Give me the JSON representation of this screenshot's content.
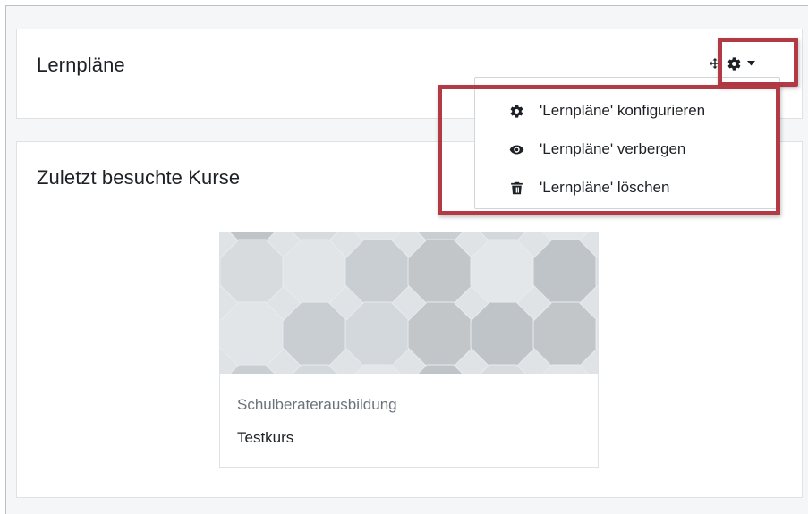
{
  "blocks": {
    "lernplaene": {
      "title": "Lernpläne",
      "controls": {
        "move_icon": "move-icon",
        "gear_icon": "gear-icon",
        "caret_icon": "caret-down-icon"
      }
    },
    "recent_courses": {
      "title": "Zuletzt besuchte Kurse",
      "courses": [
        {
          "category": "Schulberaterausbildung",
          "name": "Testkurs"
        }
      ]
    }
  },
  "dropdown": {
    "items": [
      {
        "label": "'Lernpläne' konfigurieren",
        "icon": "gear-icon"
      },
      {
        "label": "'Lernpläne' verbergen",
        "icon": "eye-icon"
      },
      {
        "label": "'Lernpläne' löschen",
        "icon": "trash-icon"
      }
    ]
  },
  "colors": {
    "highlight_border": "#b23a44",
    "page_background": "#f4f6f8",
    "text": "#1d2125",
    "muted_text": "#6a737b"
  }
}
